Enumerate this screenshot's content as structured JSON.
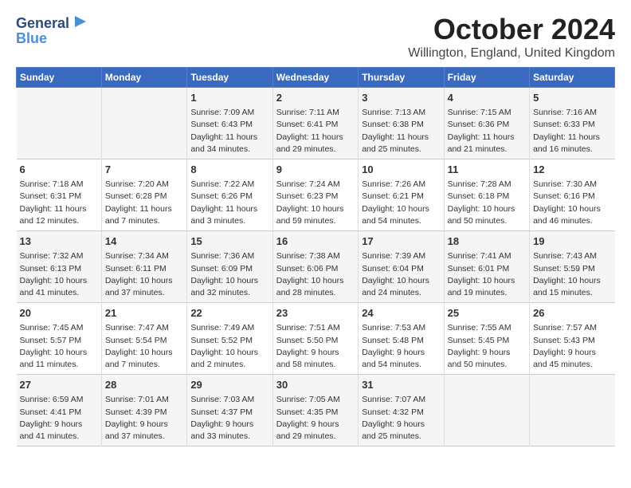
{
  "logo": {
    "line1": "General",
    "line2": "Blue"
  },
  "title": "October 2024",
  "subtitle": "Willington, England, United Kingdom",
  "headers": [
    "Sunday",
    "Monday",
    "Tuesday",
    "Wednesday",
    "Thursday",
    "Friday",
    "Saturday"
  ],
  "weeks": [
    [
      {
        "day": "",
        "info": ""
      },
      {
        "day": "",
        "info": ""
      },
      {
        "day": "1",
        "info": "Sunrise: 7:09 AM\nSunset: 6:43 PM\nDaylight: 11 hours\nand 34 minutes."
      },
      {
        "day": "2",
        "info": "Sunrise: 7:11 AM\nSunset: 6:41 PM\nDaylight: 11 hours\nand 29 minutes."
      },
      {
        "day": "3",
        "info": "Sunrise: 7:13 AM\nSunset: 6:38 PM\nDaylight: 11 hours\nand 25 minutes."
      },
      {
        "day": "4",
        "info": "Sunrise: 7:15 AM\nSunset: 6:36 PM\nDaylight: 11 hours\nand 21 minutes."
      },
      {
        "day": "5",
        "info": "Sunrise: 7:16 AM\nSunset: 6:33 PM\nDaylight: 11 hours\nand 16 minutes."
      }
    ],
    [
      {
        "day": "6",
        "info": "Sunrise: 7:18 AM\nSunset: 6:31 PM\nDaylight: 11 hours\nand 12 minutes."
      },
      {
        "day": "7",
        "info": "Sunrise: 7:20 AM\nSunset: 6:28 PM\nDaylight: 11 hours\nand 7 minutes."
      },
      {
        "day": "8",
        "info": "Sunrise: 7:22 AM\nSunset: 6:26 PM\nDaylight: 11 hours\nand 3 minutes."
      },
      {
        "day": "9",
        "info": "Sunrise: 7:24 AM\nSunset: 6:23 PM\nDaylight: 10 hours\nand 59 minutes."
      },
      {
        "day": "10",
        "info": "Sunrise: 7:26 AM\nSunset: 6:21 PM\nDaylight: 10 hours\nand 54 minutes."
      },
      {
        "day": "11",
        "info": "Sunrise: 7:28 AM\nSunset: 6:18 PM\nDaylight: 10 hours\nand 50 minutes."
      },
      {
        "day": "12",
        "info": "Sunrise: 7:30 AM\nSunset: 6:16 PM\nDaylight: 10 hours\nand 46 minutes."
      }
    ],
    [
      {
        "day": "13",
        "info": "Sunrise: 7:32 AM\nSunset: 6:13 PM\nDaylight: 10 hours\nand 41 minutes."
      },
      {
        "day": "14",
        "info": "Sunrise: 7:34 AM\nSunset: 6:11 PM\nDaylight: 10 hours\nand 37 minutes."
      },
      {
        "day": "15",
        "info": "Sunrise: 7:36 AM\nSunset: 6:09 PM\nDaylight: 10 hours\nand 32 minutes."
      },
      {
        "day": "16",
        "info": "Sunrise: 7:38 AM\nSunset: 6:06 PM\nDaylight: 10 hours\nand 28 minutes."
      },
      {
        "day": "17",
        "info": "Sunrise: 7:39 AM\nSunset: 6:04 PM\nDaylight: 10 hours\nand 24 minutes."
      },
      {
        "day": "18",
        "info": "Sunrise: 7:41 AM\nSunset: 6:01 PM\nDaylight: 10 hours\nand 19 minutes."
      },
      {
        "day": "19",
        "info": "Sunrise: 7:43 AM\nSunset: 5:59 PM\nDaylight: 10 hours\nand 15 minutes."
      }
    ],
    [
      {
        "day": "20",
        "info": "Sunrise: 7:45 AM\nSunset: 5:57 PM\nDaylight: 10 hours\nand 11 minutes."
      },
      {
        "day": "21",
        "info": "Sunrise: 7:47 AM\nSunset: 5:54 PM\nDaylight: 10 hours\nand 7 minutes."
      },
      {
        "day": "22",
        "info": "Sunrise: 7:49 AM\nSunset: 5:52 PM\nDaylight: 10 hours\nand 2 minutes."
      },
      {
        "day": "23",
        "info": "Sunrise: 7:51 AM\nSunset: 5:50 PM\nDaylight: 9 hours\nand 58 minutes."
      },
      {
        "day": "24",
        "info": "Sunrise: 7:53 AM\nSunset: 5:48 PM\nDaylight: 9 hours\nand 54 minutes."
      },
      {
        "day": "25",
        "info": "Sunrise: 7:55 AM\nSunset: 5:45 PM\nDaylight: 9 hours\nand 50 minutes."
      },
      {
        "day": "26",
        "info": "Sunrise: 7:57 AM\nSunset: 5:43 PM\nDaylight: 9 hours\nand 45 minutes."
      }
    ],
    [
      {
        "day": "27",
        "info": "Sunrise: 6:59 AM\nSunset: 4:41 PM\nDaylight: 9 hours\nand 41 minutes."
      },
      {
        "day": "28",
        "info": "Sunrise: 7:01 AM\nSunset: 4:39 PM\nDaylight: 9 hours\nand 37 minutes."
      },
      {
        "day": "29",
        "info": "Sunrise: 7:03 AM\nSunset: 4:37 PM\nDaylight: 9 hours\nand 33 minutes."
      },
      {
        "day": "30",
        "info": "Sunrise: 7:05 AM\nSunset: 4:35 PM\nDaylight: 9 hours\nand 29 minutes."
      },
      {
        "day": "31",
        "info": "Sunrise: 7:07 AM\nSunset: 4:32 PM\nDaylight: 9 hours\nand 25 minutes."
      },
      {
        "day": "",
        "info": ""
      },
      {
        "day": "",
        "info": ""
      }
    ]
  ]
}
